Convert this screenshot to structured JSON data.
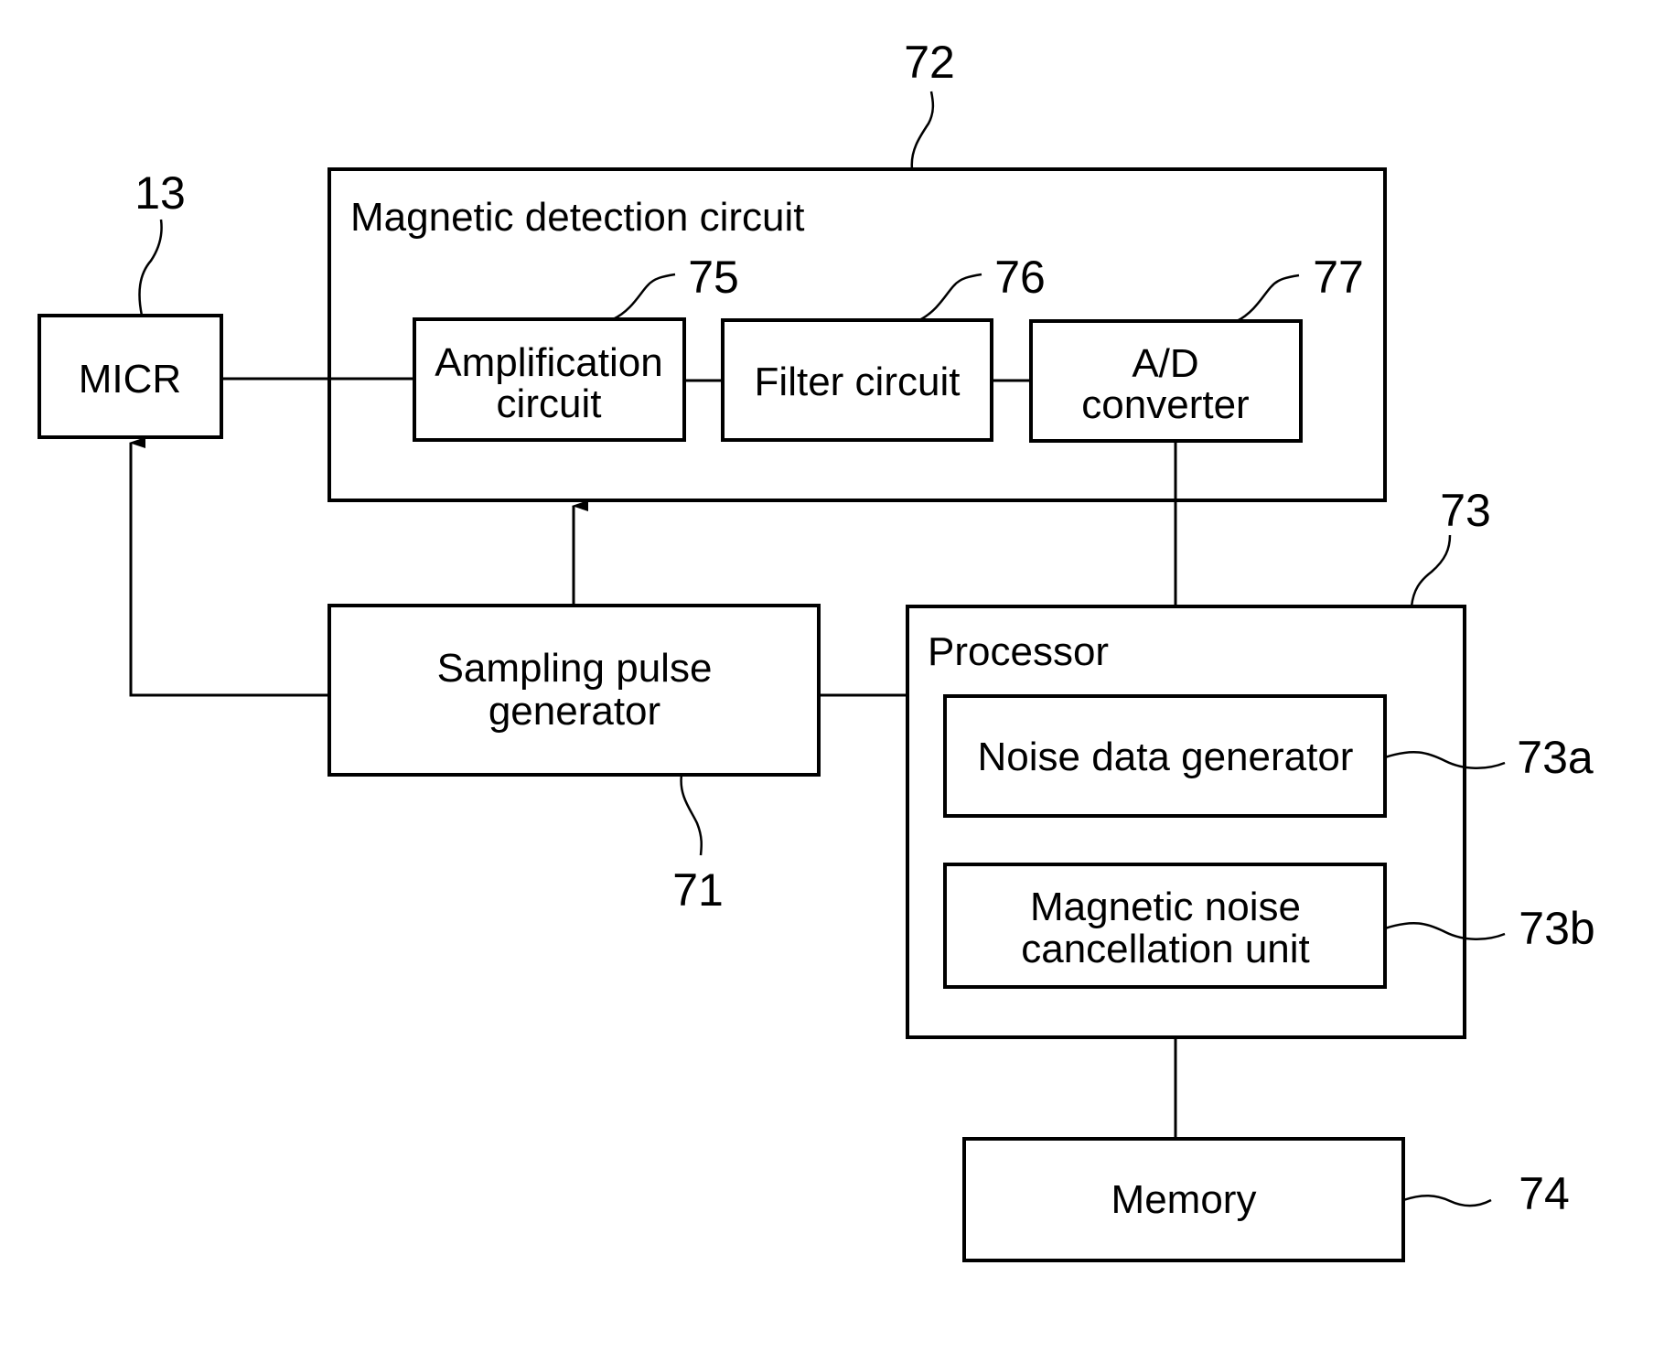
{
  "diagram": {
    "micr": {
      "label": "MICR",
      "ref": "13"
    },
    "magnetic_detection_circuit": {
      "label": "Magnetic detection circuit",
      "ref": "72",
      "amplification": {
        "line1": "Amplification",
        "line2": "circuit",
        "ref": "75"
      },
      "filter": {
        "label": "Filter circuit",
        "ref": "76"
      },
      "ad_converter": {
        "line1": "A/D",
        "line2": "converter",
        "ref": "77"
      }
    },
    "sampling_pulse_generator": {
      "line1": "Sampling pulse",
      "line2": "generator",
      "ref": "71"
    },
    "processor": {
      "label": "Processor",
      "ref": "73",
      "noise_data_generator": {
        "label": "Noise data generator",
        "ref": "73a"
      },
      "magnetic_noise_cancellation": {
        "line1": "Magnetic noise",
        "line2": "cancellation unit",
        "ref": "73b"
      }
    },
    "memory": {
      "label": "Memory",
      "ref": "74"
    }
  }
}
